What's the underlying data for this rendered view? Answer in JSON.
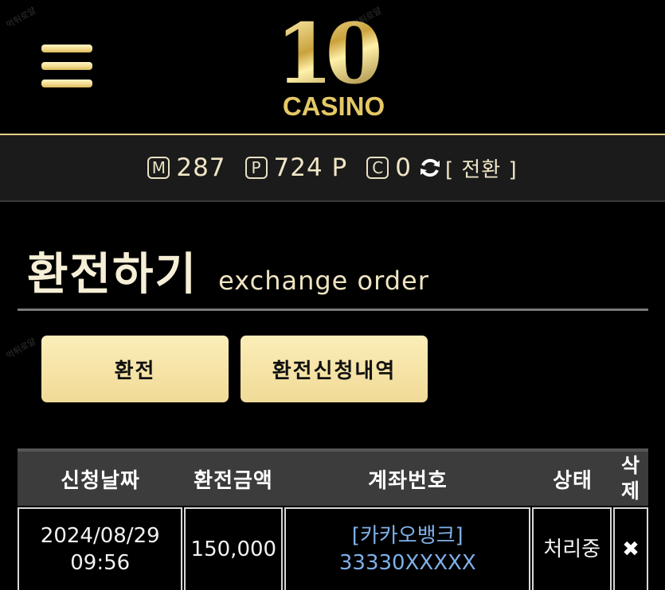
{
  "header": {
    "logo_number": "10",
    "logo_text": "CASINO",
    "watermark": "먹튀로얄"
  },
  "points": {
    "money_icon": "M",
    "money_value": "287",
    "point_icon": "P",
    "point_value": "724 P",
    "coupon_icon": "C",
    "coupon_value": "0",
    "convert_label": "[ 전환 ]"
  },
  "page": {
    "title_ko": "환전하기",
    "title_en": "exchange order"
  },
  "tabs": {
    "exchange_label": "환전",
    "history_label": "환전신청내역"
  },
  "table": {
    "headers": {
      "date": "신청날짜",
      "amount": "환전금액",
      "account": "계좌번호",
      "status": "상태",
      "delete": "삭제"
    },
    "rows": [
      {
        "date": "2024/08/29",
        "time": "09:56",
        "amount": "150,000",
        "bank": "[카카오뱅크]",
        "account": "33330XXXXX",
        "status": "처리중",
        "delete_icon": "✖"
      }
    ]
  },
  "colors": {
    "accent_gold": "#f1da97",
    "bank_link": "#7fb0e8",
    "background": "#000000"
  },
  "icons": [
    "hamburger-menu-icon",
    "refresh-icon",
    "close-icon"
  ]
}
